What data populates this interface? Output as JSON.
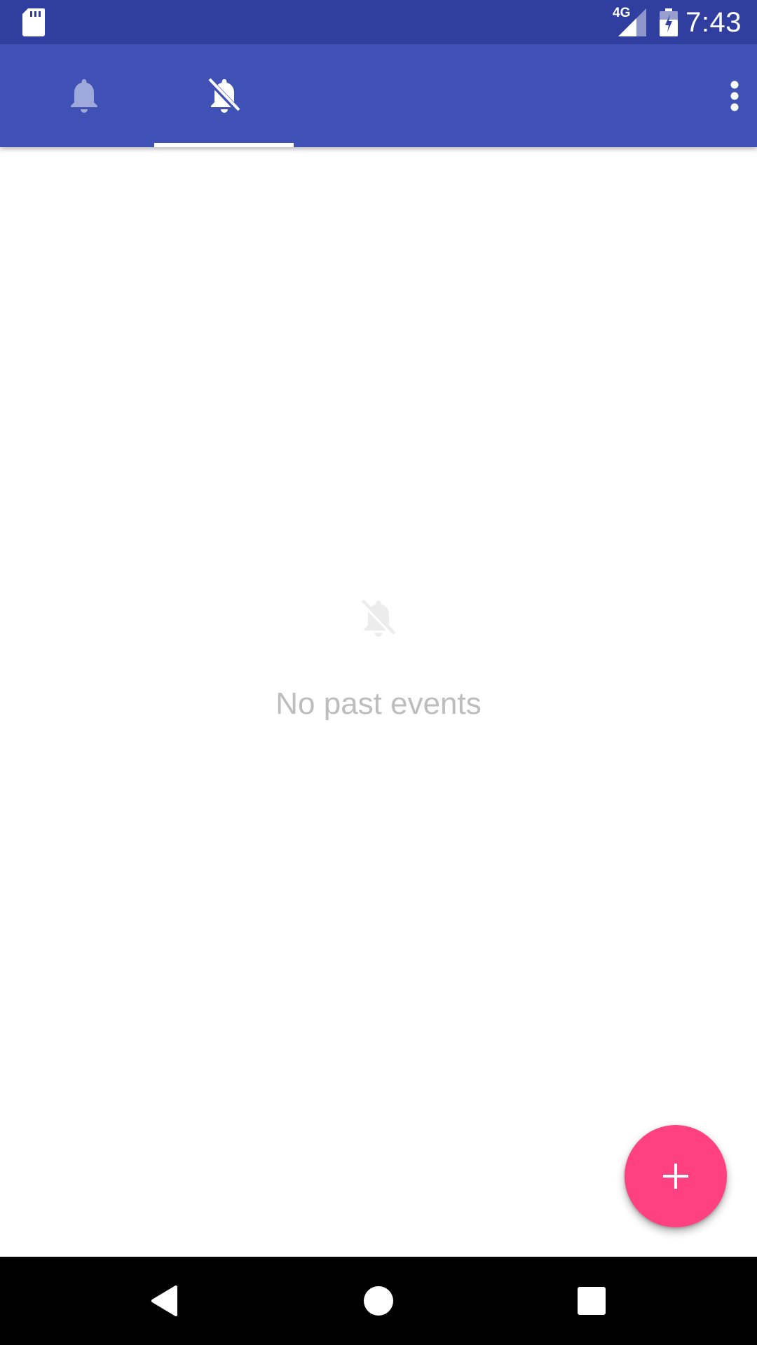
{
  "status_bar": {
    "time": "7:43",
    "network_label": "4G",
    "icons": [
      "sd-card-icon",
      "signal-4g-icon",
      "battery-charging-icon"
    ]
  },
  "app_bar": {
    "tabs": [
      {
        "icon": "bell-icon",
        "selected": false
      },
      {
        "icon": "bell-off-icon",
        "selected": true
      }
    ],
    "overflow_icon": "more-vert-icon",
    "colors": {
      "primary": "#3f51b5",
      "primary_dark": "#303f9f",
      "inactive_tab_icon": "#9fa8da"
    }
  },
  "empty_state": {
    "icon": "bell-off-icon",
    "message": "No past events"
  },
  "fab": {
    "icon": "plus-icon",
    "color": "#ff4081"
  },
  "nav_bar": {
    "icons": [
      "back-icon",
      "home-icon",
      "recents-icon"
    ]
  }
}
